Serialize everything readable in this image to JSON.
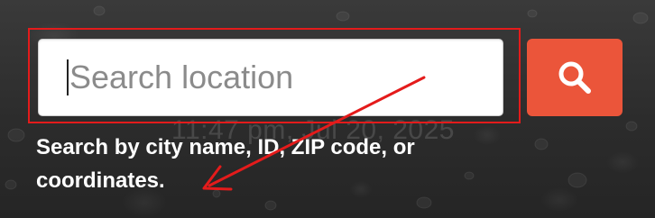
{
  "search": {
    "placeholder": "Search location",
    "value": "",
    "button_icon": "search-icon",
    "button_color": "#eb553a"
  },
  "background_clock": "11:47 pm, Jul 20, 2025",
  "hint": "Search by city name, ID, ZIP code, or coordinates.",
  "annotation": {
    "box_color": "#e41b1b",
    "arrow_color": "#e41b1b"
  }
}
